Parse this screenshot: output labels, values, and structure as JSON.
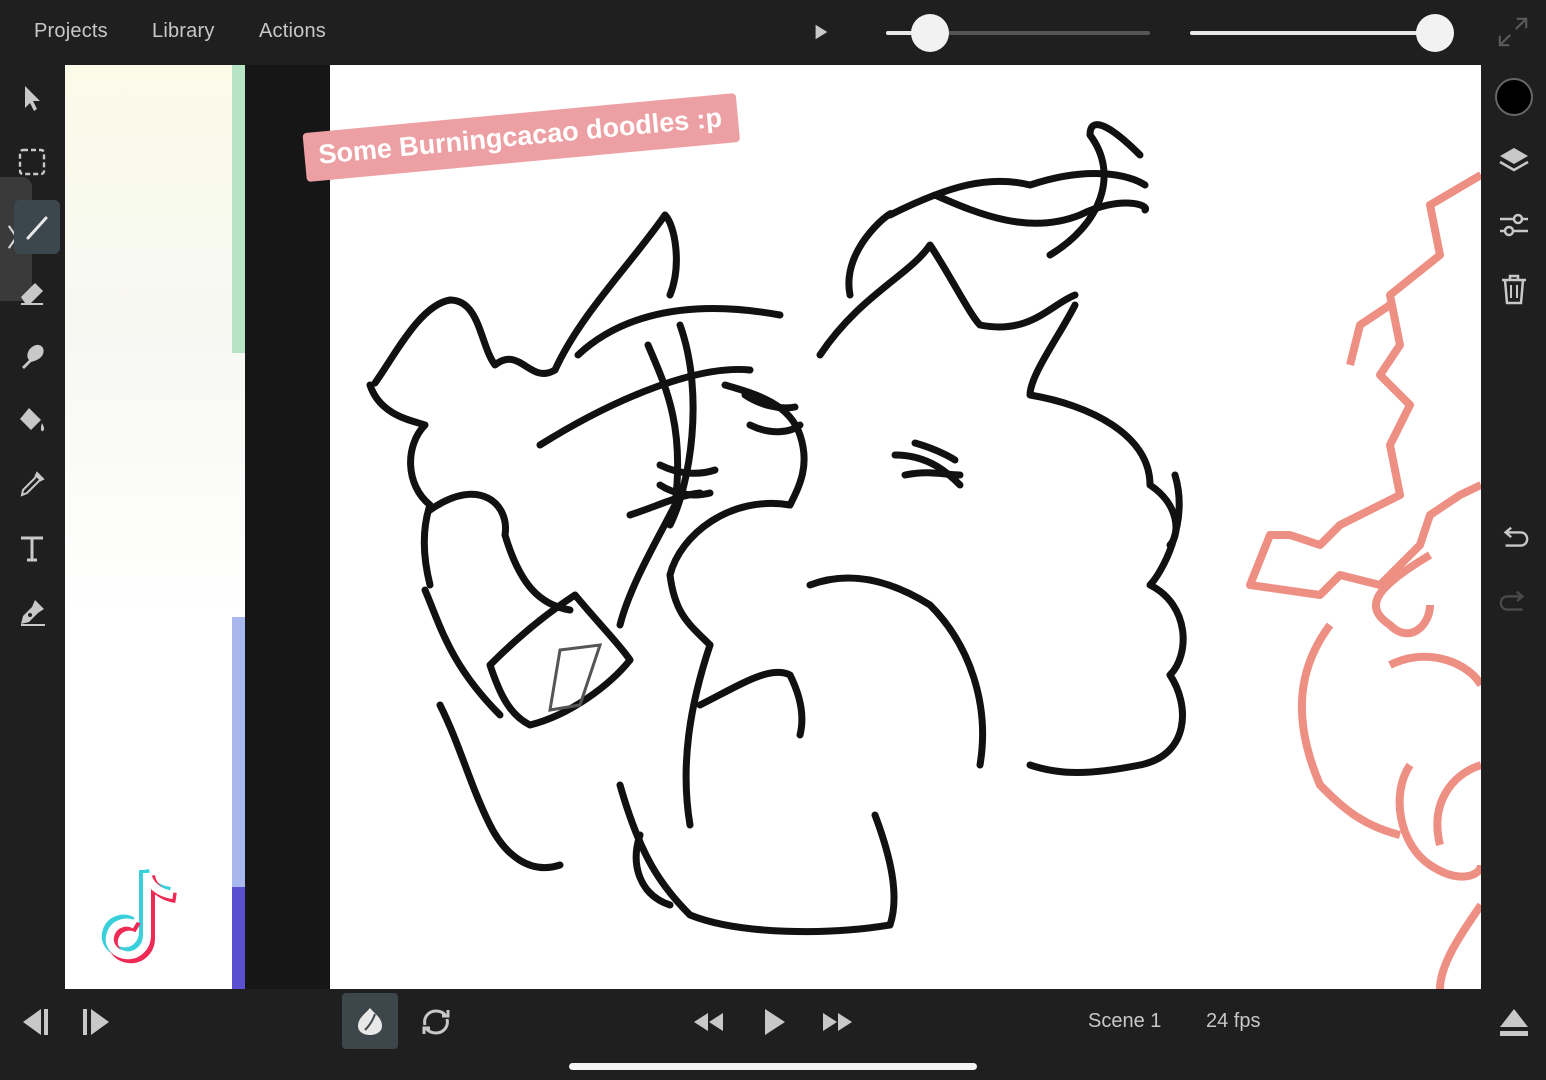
{
  "menu": {
    "projects": "Projects",
    "library": "Library",
    "actions": "Actions"
  },
  "sliders": {
    "brush_size_level": 0.11,
    "opacity_level": 1.0
  },
  "colors": {
    "current_color": "#000000",
    "accent_pink": "#eda0a3",
    "sketch_pink": "#ee8f84",
    "toolbar_bg": "#1f1f1f"
  },
  "left_tools": [
    {
      "name": "select-arrow-icon"
    },
    {
      "name": "marquee-select-icon"
    },
    {
      "name": "brush-icon",
      "active": true
    },
    {
      "name": "eraser-icon"
    },
    {
      "name": "smudge-icon"
    },
    {
      "name": "fill-bucket-icon"
    },
    {
      "name": "eyedropper-icon"
    },
    {
      "name": "text-icon"
    },
    {
      "name": "pen-icon"
    }
  ],
  "right_tools": [
    {
      "name": "color-swatch"
    },
    {
      "name": "layers-icon"
    },
    {
      "name": "adjustments-icon"
    },
    {
      "name": "trash-icon"
    },
    {
      "name": "undo-icon"
    },
    {
      "name": "redo-icon"
    }
  ],
  "canvas": {
    "caption": "Some Burningcacao doodles :p"
  },
  "timeline": {
    "scene": "Scene 1",
    "fps": "24 fps"
  }
}
